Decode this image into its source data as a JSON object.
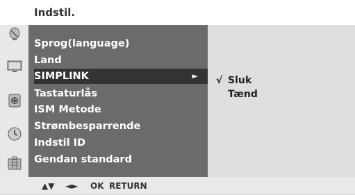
{
  "header": {
    "title": "Indstil."
  },
  "sidebar_icons": [
    "satellite-dish-icon",
    "tv-screen-icon",
    "speaker-icon",
    "clock-icon",
    "lock-grid-icon"
  ],
  "menu": {
    "items": [
      {
        "label": "Sprog(language)"
      },
      {
        "label": "Land"
      },
      {
        "label": "SIMPLINK",
        "selected": true,
        "arrow": "►"
      },
      {
        "label": "Tastaturlås"
      },
      {
        "label": "ISM Metode"
      },
      {
        "label": "Strømbesparrende"
      },
      {
        "label": "Indstil ID"
      },
      {
        "label": "Gendan standard"
      }
    ]
  },
  "submenu": {
    "check": "√",
    "options": [
      "Sluk",
      "Tænd"
    ]
  },
  "footer": {
    "nav_updown": "▲▼",
    "nav_leftright": "◄►",
    "ok": "OK",
    "return": "RETURN"
  }
}
